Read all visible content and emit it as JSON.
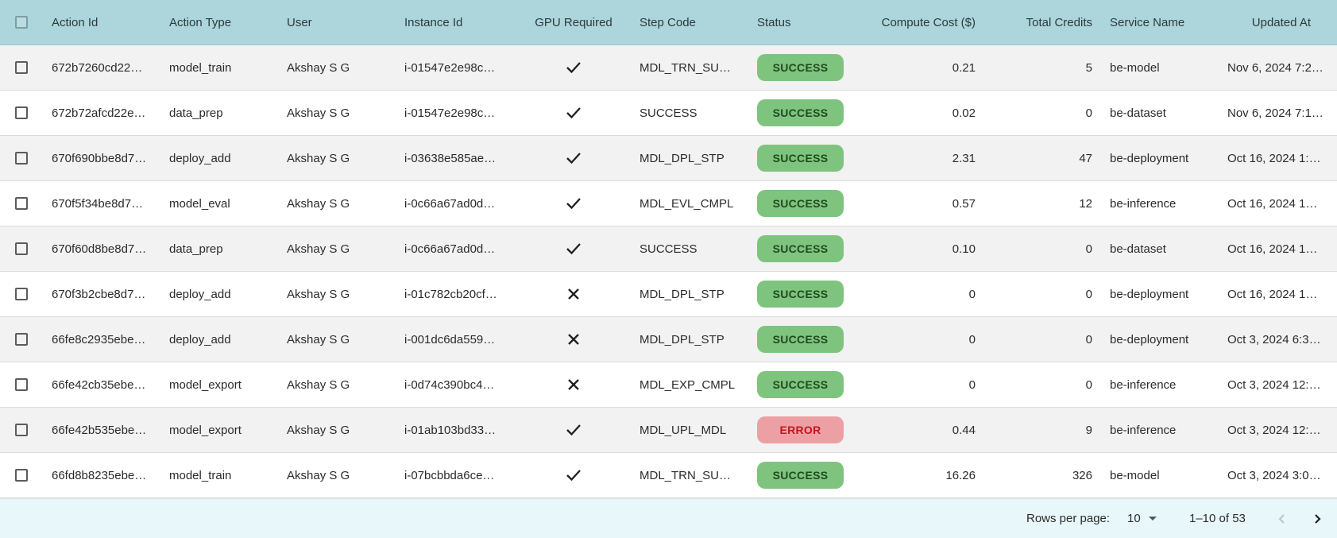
{
  "table": {
    "headers": {
      "action_id": "Action Id",
      "action_type": "Action Type",
      "user": "User",
      "instance_id": "Instance Id",
      "gpu_required": "GPU Required",
      "step_code": "Step Code",
      "status": "Status",
      "compute_cost": "Compute Cost ($)",
      "total_credits": "Total Credits",
      "service_name": "Service Name",
      "updated_at": "Updated At"
    },
    "rows": [
      {
        "action_id": "672b7260cd22…",
        "action_type": "model_train",
        "user": "Akshay S G",
        "instance_id": "i-01547e2e98c…",
        "gpu_icon": "check-icon",
        "step_code": "MDL_TRN_SU…",
        "status": "SUCCESS",
        "status_kind": "success",
        "compute_cost": "0.21",
        "total_credits": "5",
        "service_name": "be-model",
        "updated_at": "Nov 6, 2024 7:2…"
      },
      {
        "action_id": "672b72afcd22e…",
        "action_type": "data_prep",
        "user": "Akshay S G",
        "instance_id": "i-01547e2e98c…",
        "gpu_icon": "check-icon",
        "step_code": "SUCCESS",
        "status": "SUCCESS",
        "status_kind": "success",
        "compute_cost": "0.02",
        "total_credits": "0",
        "service_name": "be-dataset",
        "updated_at": "Nov 6, 2024 7:1…"
      },
      {
        "action_id": "670f690bbe8d7…",
        "action_type": "deploy_add",
        "user": "Akshay S G",
        "instance_id": "i-03638e585ae…",
        "gpu_icon": "check-icon",
        "step_code": "MDL_DPL_STP",
        "status": "SUCCESS",
        "status_kind": "success",
        "compute_cost": "2.31",
        "total_credits": "47",
        "service_name": "be-deployment",
        "updated_at": "Oct 16, 2024 1:…"
      },
      {
        "action_id": "670f5f34be8d7…",
        "action_type": "model_eval",
        "user": "Akshay S G",
        "instance_id": "i-0c66a67ad0d…",
        "gpu_icon": "check-icon",
        "step_code": "MDL_EVL_CMPL",
        "status": "SUCCESS",
        "status_kind": "success",
        "compute_cost": "0.57",
        "total_credits": "12",
        "service_name": "be-inference",
        "updated_at": "Oct 16, 2024 1…"
      },
      {
        "action_id": "670f60d8be8d7…",
        "action_type": "data_prep",
        "user": "Akshay S G",
        "instance_id": "i-0c66a67ad0d…",
        "gpu_icon": "check-icon",
        "step_code": "SUCCESS",
        "status": "SUCCESS",
        "status_kind": "success",
        "compute_cost": "0.10",
        "total_credits": "0",
        "service_name": "be-dataset",
        "updated_at": "Oct 16, 2024 1…"
      },
      {
        "action_id": "670f3b2cbe8d7…",
        "action_type": "deploy_add",
        "user": "Akshay S G",
        "instance_id": "i-01c782cb20cf…",
        "gpu_icon": "cross-icon",
        "step_code": "MDL_DPL_STP",
        "status": "SUCCESS",
        "status_kind": "success",
        "compute_cost": "0",
        "total_credits": "0",
        "service_name": "be-deployment",
        "updated_at": "Oct 16, 2024 1…"
      },
      {
        "action_id": "66fe8c2935ebe…",
        "action_type": "deploy_add",
        "user": "Akshay S G",
        "instance_id": "i-001dc6da559…",
        "gpu_icon": "cross-icon",
        "step_code": "MDL_DPL_STP",
        "status": "SUCCESS",
        "status_kind": "success",
        "compute_cost": "0",
        "total_credits": "0",
        "service_name": "be-deployment",
        "updated_at": "Oct 3, 2024 6:3…"
      },
      {
        "action_id": "66fe42cb35ebe…",
        "action_type": "model_export",
        "user": "Akshay S G",
        "instance_id": "i-0d74c390bc4…",
        "gpu_icon": "cross-icon",
        "step_code": "MDL_EXP_CMPL",
        "status": "SUCCESS",
        "status_kind": "success",
        "compute_cost": "0",
        "total_credits": "0",
        "service_name": "be-inference",
        "updated_at": "Oct 3, 2024 12:…"
      },
      {
        "action_id": "66fe42b535ebe…",
        "action_type": "model_export",
        "user": "Akshay S G",
        "instance_id": "i-01ab103bd33…",
        "gpu_icon": "check-icon",
        "step_code": "MDL_UPL_MDL",
        "status": "ERROR",
        "status_kind": "error",
        "compute_cost": "0.44",
        "total_credits": "9",
        "service_name": "be-inference",
        "updated_at": "Oct 3, 2024 12:…"
      },
      {
        "action_id": "66fd8b8235ebe…",
        "action_type": "model_train",
        "user": "Akshay S G",
        "instance_id": "i-07bcbbda6ce…",
        "gpu_icon": "check-icon",
        "step_code": "MDL_TRN_SU…",
        "status": "SUCCESS",
        "status_kind": "success",
        "compute_cost": "16.26",
        "total_credits": "326",
        "service_name": "be-model",
        "updated_at": "Oct 3, 2024 3:0…"
      }
    ]
  },
  "pagination": {
    "rows_per_page_label": "Rows per page:",
    "rows_per_page_value": "10",
    "range_text": "1–10 of 53",
    "prev_icon": "chevron-left-icon",
    "next_icon": "chevron-right-icon"
  },
  "colors": {
    "header_bg": "#acd6db",
    "success_bg": "#7fc47e",
    "error_bg": "#eda0a3",
    "footer_bg": "#e8f7fa"
  }
}
